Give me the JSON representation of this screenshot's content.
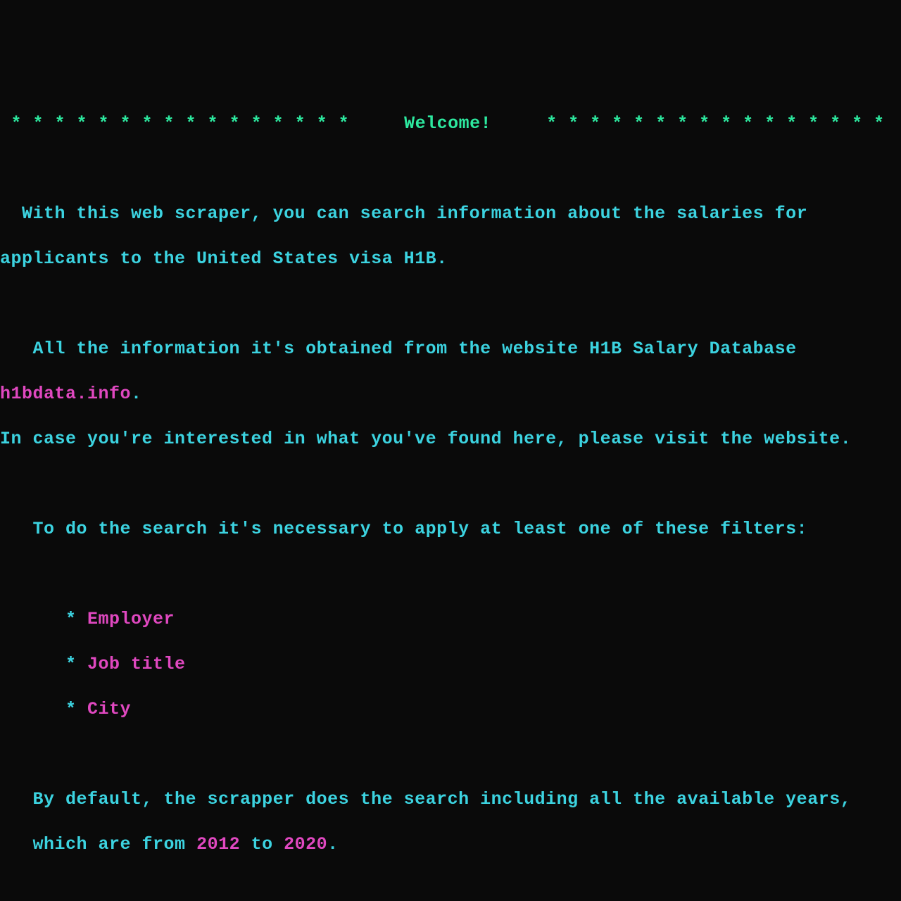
{
  "banner": {
    "stars_left": " * * * * * * * * * * * * * * * *",
    "title": "Welcome!",
    "stars_right": "* * * * * * * * * * * * * * * *"
  },
  "intro": {
    "line1": "  With this web scraper, you can search information about the salaries for",
    "line2": "applicants to the United States visa H1B."
  },
  "source": {
    "line1": "   All the information it's obtained from the website H1B Salary Database",
    "link": "h1bdata.info",
    "period": ".",
    "line3": "In case you're interested in what you've found here, please visit the website."
  },
  "filters_intro": "   To do the search it's necessary to apply at least one of these filters:",
  "filters": {
    "bullet_prefix": "      * ",
    "items": [
      "Employer",
      "Job title",
      "City"
    ]
  },
  "years": {
    "prefix": "   By default, the scrapper does the search including all the available years,",
    "line2_prefix": "   which are from ",
    "from": "2012",
    "mid": " to ",
    "to": "2020",
    "suffix": "."
  }
}
